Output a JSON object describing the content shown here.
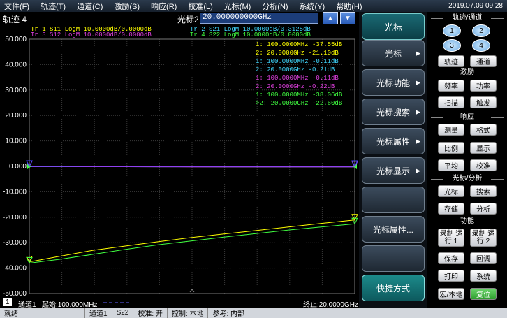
{
  "menubar": {
    "items": [
      "文件(F)",
      "轨迹(T)",
      "通道(C)",
      "激励(S)",
      "响应(R)",
      "校准(L)",
      "光标(M)",
      "分析(N)",
      "系统(Y)",
      "帮助(H)"
    ],
    "datetime": "2019.07.09 09:28"
  },
  "trace_header": {
    "title": "轨迹 4",
    "marker_label": "光标2",
    "marker_value": "20.000000000GHz"
  },
  "trace_legend": [
    {
      "text": "Tr  1   S11  LogM  10.0000dB/0.0000dB",
      "color": "#ffff00"
    },
    {
      "text": "Tr  3   S12  LogM  10.0000dB/0.0000dB",
      "color": "#e040e0"
    },
    {
      "text": "Tr  2   S21  LogM  10.0000dB/0.3125dB",
      "color": "#40d8ff"
    },
    {
      "text": "Tr  4   S22  LogM  10.0000dB/0.0000dB",
      "color": "#40ff40"
    }
  ],
  "marker_readouts": [
    {
      "text": "1:    100.0000MHz  -37.55dB",
      "color": "#ffff00"
    },
    {
      "text": "2:     20.0000GHz  -21.10dB",
      "color": "#ffff00"
    },
    {
      "text": "1:    100.0000MHz  -0.11dB",
      "color": "#40d8ff"
    },
    {
      "text": "2:     20.0000GHz  -0.21dB",
      "color": "#40d8ff"
    },
    {
      "text": "1:    100.0000MHz  -0.11dB",
      "color": "#e040e0"
    },
    {
      "text": "2:     20.0000GHz  -0.22dB",
      "color": "#e040e0"
    },
    {
      "text": "1:    100.0000MHz  -38.06dB",
      "color": "#40ff40"
    },
    {
      "text": ">2:    20.0000GHz  -22.60dB",
      "color": "#40ff40"
    }
  ],
  "chart_data": {
    "type": "line",
    "ylim": [
      -50,
      50
    ],
    "ytick_labels": [
      "50.000",
      "40.000",
      "30.000",
      "20.000",
      "10.000",
      "0.000",
      "-10.000",
      "-20.000",
      "-30.000",
      "-40.000",
      "-50.000"
    ],
    "x_start": "100.000MHz",
    "x_stop": "20.0000GHz",
    "x": [
      0.1,
      2.0,
      4.0,
      6.0,
      8.0,
      10.0,
      12.0,
      14.0,
      16.0,
      18.0,
      20.0
    ],
    "series": [
      {
        "color": "#ffff00",
        "values": [
          -37.55,
          -35.3,
          -33.0,
          -31.3,
          -29.6,
          -28.0,
          -26.6,
          -25.2,
          -23.8,
          -22.4,
          -21.1
        ]
      },
      {
        "color": "#40ff40",
        "values": [
          -38.06,
          -36.5,
          -34.6,
          -32.6,
          -30.8,
          -29.3,
          -27.8,
          -26.4,
          -25.0,
          -23.8,
          -22.6
        ]
      },
      {
        "color": "#40d8ff",
        "values": [
          -0.11,
          -0.12,
          -0.14,
          -0.15,
          -0.16,
          -0.17,
          -0.18,
          -0.19,
          -0.2,
          -0.2,
          -0.21
        ]
      },
      {
        "color": "#e040e0",
        "values": [
          -0.11,
          -0.12,
          -0.14,
          -0.15,
          -0.17,
          -0.18,
          -0.19,
          -0.2,
          -0.21,
          -0.21,
          -0.22
        ]
      },
      {
        "color": "#4040ff",
        "values": [
          0.0,
          0.0,
          0.0,
          0.0,
          0.0,
          0.0,
          0.0,
          0.0,
          0.0,
          0.0,
          0.0
        ]
      }
    ]
  },
  "bottom_bar": {
    "channel_num": "1",
    "channel_label": "通道1",
    "start_label": "起始:100.000MHz",
    "stop_label": "终止:20.0000GHz"
  },
  "statusbar": {
    "items": [
      "就绪",
      "通道1",
      "S22",
      "校准: 开",
      "控制: 本地",
      "参考: 内部"
    ]
  },
  "softkeys": {
    "header": "光标",
    "items": [
      "光标",
      "光标功能",
      "光标搜索",
      "光标属性",
      "光标显示",
      "",
      "光标属性...",
      "",
      "快捷方式"
    ]
  },
  "right_panel": {
    "sections": {
      "trace_channel": "轨迹/通道",
      "stimulus": "激励",
      "response": "响应",
      "marker_analysis": "光标/分析",
      "function": "功能"
    },
    "channels": [
      "1",
      "2",
      "3",
      "4"
    ],
    "trace_channel_buttons": [
      "轨迹",
      "通道"
    ],
    "stimulus_buttons": [
      "频率",
      "功率",
      "扫描",
      "触发"
    ],
    "response_buttons": [
      "测量",
      "格式",
      "比例",
      "显示",
      "平均",
      "校准"
    ],
    "marker_analysis_buttons": [
      "光标",
      "搜索",
      "存储",
      "分析"
    ],
    "function_buttons_tall": [
      "录制 运行 1",
      "录制 运行 2"
    ],
    "function_buttons": [
      "保存",
      "回调",
      "打印",
      "系统",
      "宏/本地",
      "复位"
    ]
  }
}
